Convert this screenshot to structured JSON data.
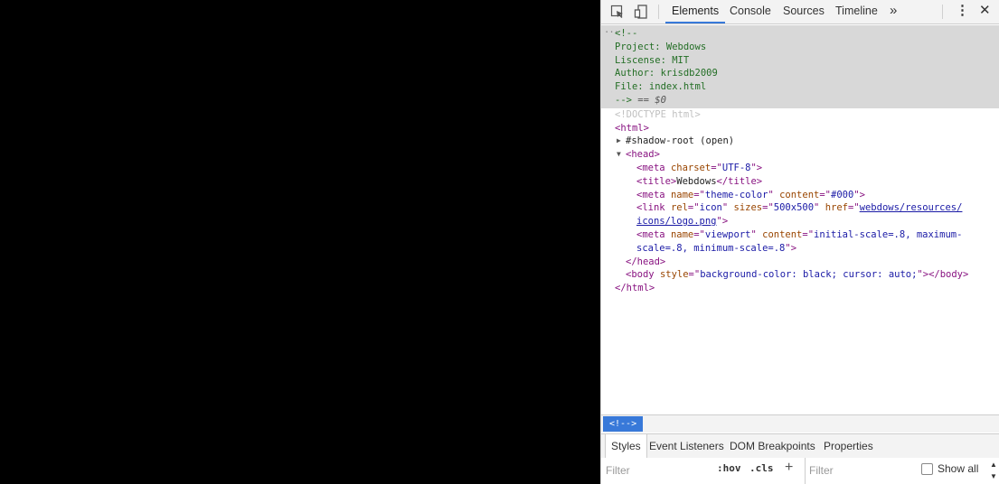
{
  "devtools": {
    "tabs": [
      "Elements",
      "Console",
      "Sources",
      "Timeline"
    ],
    "active_tab": "Elements",
    "more_label": "»",
    "kebab_label": "⋮",
    "close_label": "✕"
  },
  "dom": {
    "comment_open": "<!--",
    "comment_lines": [
      "Project: Webdows",
      "Liscense: MIT",
      "Author: krisdb2009",
      "File: index.html"
    ],
    "comment_close": "-->",
    "selected_marker": " == $0",
    "doctype": "<!DOCTYPE html>",
    "html_open": "<html>",
    "shadow_root": "#shadow-root (open)",
    "head_open": "<head>",
    "meta_charset": {
      "tag": "meta",
      "attr": "charset",
      "val": "UTF-8"
    },
    "title_tag": {
      "text": "Webdows"
    },
    "meta_theme": {
      "name": "theme-color",
      "content": "#000"
    },
    "link_icon": {
      "rel": "icon",
      "sizes": "500x500",
      "href_1": "webdows/resources/",
      "href_2": "icons/logo.png"
    },
    "meta_viewport": {
      "name": "viewport",
      "content_1": "initial-scale=.8, maximum-",
      "content_2": "scale=.8, minimum-scale=.8"
    },
    "head_close": "</head>",
    "body_tag": {
      "style": "background-color: black; cursor: auto;"
    },
    "html_close": "</html>"
  },
  "breadcrumb": {
    "label": "<!-->"
  },
  "styles_panel": {
    "tabs": [
      "Styles",
      "Event Listeners",
      "DOM Breakpoints",
      "Properties"
    ],
    "active_tab": "Styles",
    "filter_placeholder": "Filter",
    "hov_label": ":hov",
    "cls_label": ".cls",
    "add_label": "+",
    "filter2_placeholder": "Filter",
    "show_all_label": "Show all"
  }
}
